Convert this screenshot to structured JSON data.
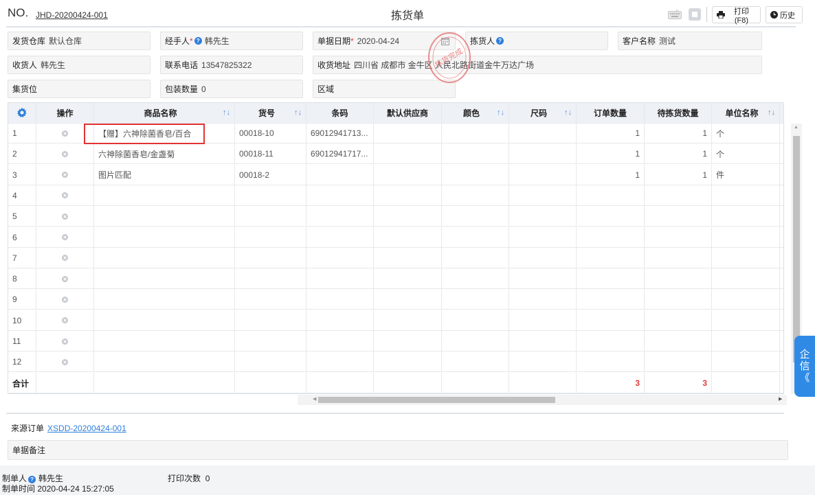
{
  "header": {
    "no_label": "NO.",
    "doc_number": "JHD-20200424-001",
    "title": "拣货单",
    "print_label": "打印(F8)",
    "history_label": "历史"
  },
  "form": {
    "warehouse": {
      "label": "发货仓库",
      "value": "默认仓库"
    },
    "handler": {
      "label": "经手人",
      "required": "*",
      "value": "韩先生"
    },
    "doc_date": {
      "label": "单据日期",
      "required": "*",
      "value": "2020-04-24"
    },
    "picker": {
      "label": "拣货人",
      "value": ""
    },
    "customer": {
      "label": "客户名称",
      "value": "测试"
    },
    "receiver": {
      "label": "收货人",
      "value": "韩先生"
    },
    "phone": {
      "label": "联系电话",
      "value": "13547825322"
    },
    "address": {
      "label": "收货地址",
      "value": "四川省 成都市 金牛区 人民北路街道金牛万达广场"
    },
    "collect_pos": {
      "label": "集货位",
      "value": ""
    },
    "pack_qty": {
      "label": "包装数量",
      "value": "0"
    },
    "area": {
      "label": "区域",
      "value": ""
    }
  },
  "stamp": {
    "text": "拣货完成"
  },
  "table": {
    "headers": {
      "op": "操作",
      "name": "商品名称",
      "code": "货号",
      "barcode": "条码",
      "supplier": "默认供应商",
      "color": "颜色",
      "size": "尺码",
      "order_qty": "订单数量",
      "pick_qty": "待拣货数量",
      "unit": "单位名称",
      "more": "2"
    },
    "rows": [
      {
        "no": "1",
        "name": "【赠】六神除菌香皂/百合",
        "code": "00018-10",
        "barcode": "69012941713...",
        "order_qty": "1",
        "pick_qty": "1",
        "unit": "个"
      },
      {
        "no": "2",
        "name": "六神除菌香皂/金盏菊",
        "code": "00018-11",
        "barcode": "69012941717...",
        "order_qty": "1",
        "pick_qty": "1",
        "unit": "个"
      },
      {
        "no": "3",
        "name": "图片匹配",
        "code": "00018-2",
        "barcode": "",
        "order_qty": "1",
        "pick_qty": "1",
        "unit": "件"
      },
      {
        "no": "4"
      },
      {
        "no": "5"
      },
      {
        "no": "6"
      },
      {
        "no": "7"
      },
      {
        "no": "8"
      },
      {
        "no": "9"
      },
      {
        "no": "10"
      },
      {
        "no": "11"
      },
      {
        "no": "12"
      }
    ],
    "total": {
      "label": "合计",
      "order_qty": "3",
      "pick_qty": "3"
    }
  },
  "footer": {
    "source_label": "来源订单",
    "source_order": "XSDD-20200424-001",
    "remark_label": "单据备注",
    "maker_label": "制单人",
    "maker": "韩先生",
    "make_time_label": "制单时间",
    "make_time": "2020-04-24 15:27:05",
    "print_count_label": "打印次数",
    "print_count": "0"
  },
  "side_widget": {
    "line1": "企",
    "line2": "信",
    "line3": "《"
  },
  "colors": {
    "accent": "#2f7fdc",
    "required": "#e23b3b",
    "highlight_box": "#e33232"
  }
}
